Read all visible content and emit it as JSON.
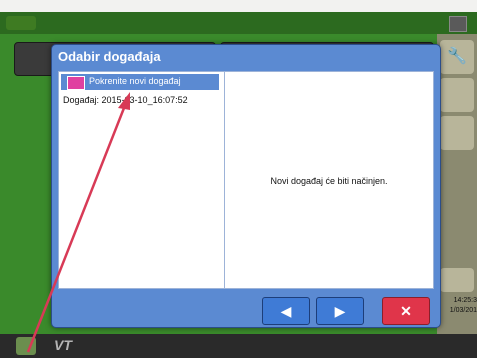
{
  "app": {
    "logo_text": "",
    "clock_time": "14:25:3",
    "clock_date": "1/03/201",
    "vt_label": "VT"
  },
  "dialog": {
    "title": "Odabir događaja",
    "list": {
      "new_item_label": "Pokrenite novi događaj",
      "event_label": "Događaj: 2015-03-10_16:07:52"
    },
    "detail_message": "Novi događaj će biti načinjen.",
    "buttons": {
      "prev_symbol": "◀",
      "next_symbol": "▶",
      "close_symbol": "✕"
    }
  },
  "colors": {
    "dialog_bg": "#5b8ad2",
    "accent_blue": "#3f7bd6",
    "close_red": "#e0354a",
    "annotation_arrow": "#d83a56"
  }
}
